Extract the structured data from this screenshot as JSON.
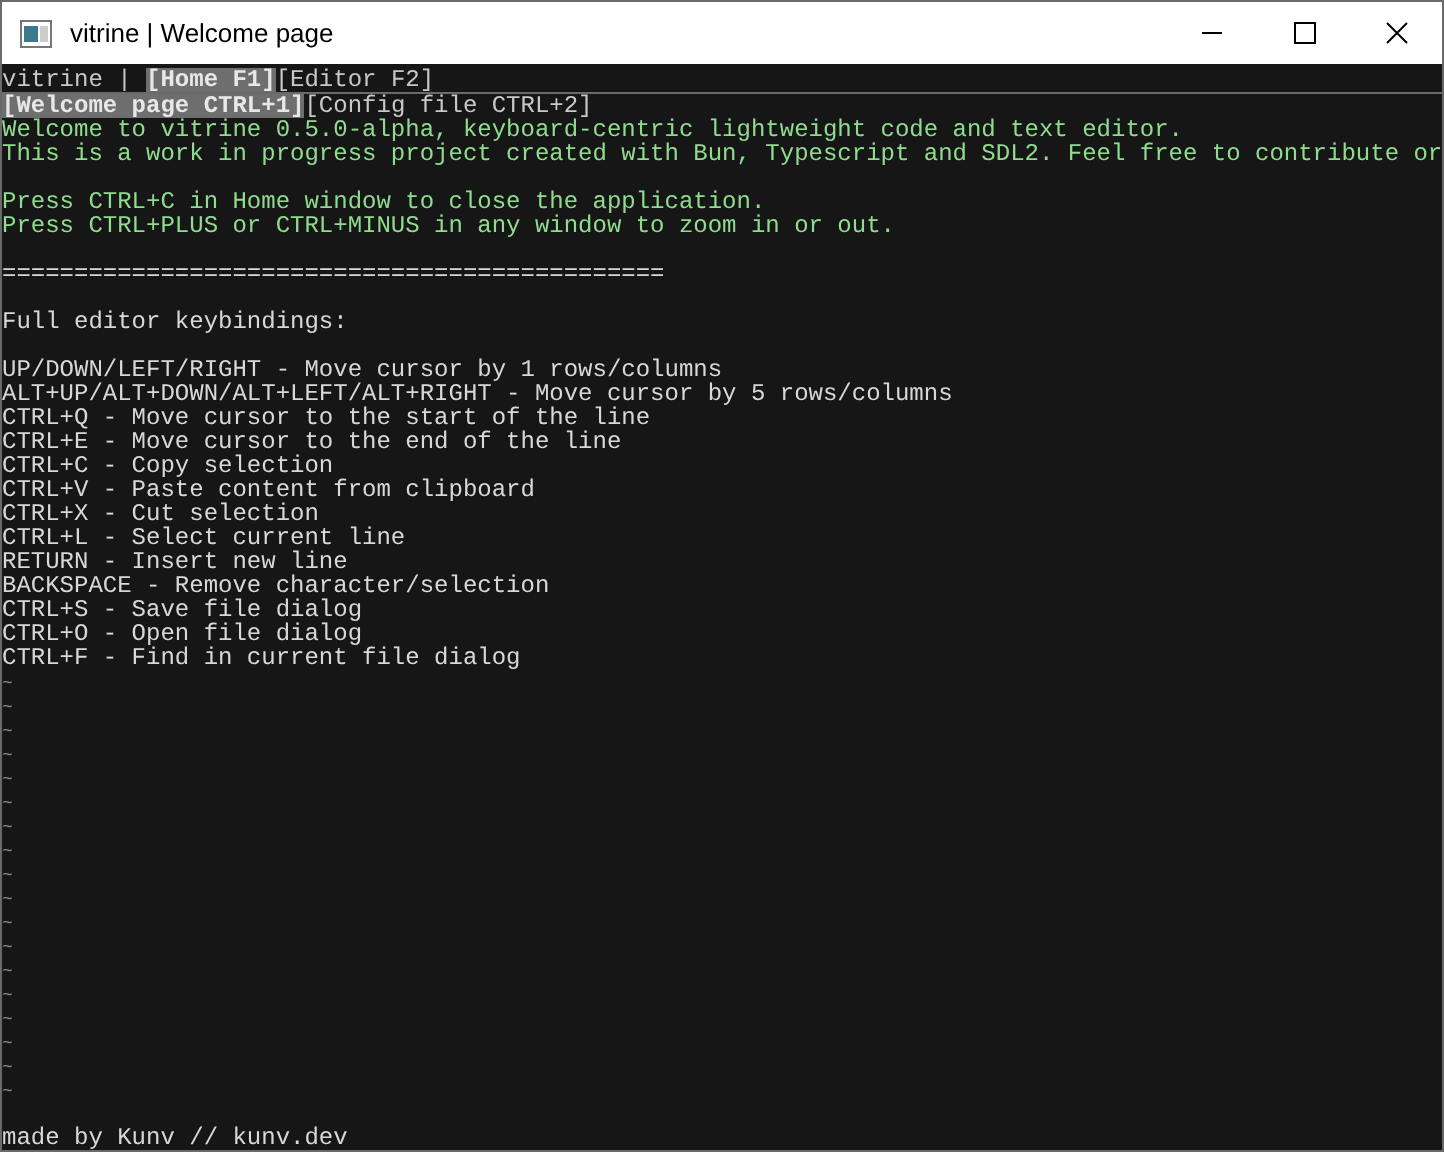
{
  "window": {
    "title": "vitrine | Welcome page"
  },
  "app_label": "vitrine | ",
  "window_tabs": [
    {
      "label": "[Home F1]",
      "selected": true
    },
    {
      "label": "[Editor F2]",
      "selected": false
    }
  ],
  "page_tabs": [
    {
      "label": "[Welcome page CTRL+1]",
      "selected": true
    },
    {
      "label": "[Config file CTRL+2]",
      "selected": false
    }
  ],
  "lines": [
    {
      "kind": "green",
      "text": "Welcome to vitrine 0.5.0-alpha, keyboard-centric lightweight code and text editor."
    },
    {
      "kind": "green",
      "text": "This is a work in progress project created with Bun, Typescript and SDL2. Feel free to contribute or"
    },
    {
      "kind": "blank"
    },
    {
      "kind": "green",
      "text": "Press CTRL+C in Home window to close the application."
    },
    {
      "kind": "green",
      "text": "Press CTRL+PLUS or CTRL+MINUS in any window to zoom in or out."
    },
    {
      "kind": "blank"
    },
    {
      "kind": "plain",
      "text": "=============================================="
    },
    {
      "kind": "blank"
    },
    {
      "kind": "plain",
      "text": "Full editor keybindings:"
    },
    {
      "kind": "blank"
    },
    {
      "kind": "plain",
      "text": "UP/DOWN/LEFT/RIGHT - Move cursor by 1 rows/columns"
    },
    {
      "kind": "plain",
      "text": "ALT+UP/ALT+DOWN/ALT+LEFT/ALT+RIGHT - Move cursor by 5 rows/columns"
    },
    {
      "kind": "plain",
      "text": "CTRL+Q - Move cursor to the start of the line"
    },
    {
      "kind": "plain",
      "text": "CTRL+E - Move cursor to the end of the line"
    },
    {
      "kind": "plain",
      "text": "CTRL+C - Copy selection"
    },
    {
      "kind": "plain",
      "text": "CTRL+V - Paste content from clipboard"
    },
    {
      "kind": "plain",
      "text": "CTRL+X - Cut selection"
    },
    {
      "kind": "plain",
      "text": "CTRL+L - Select current line"
    },
    {
      "kind": "plain",
      "text": "RETURN - Insert new line"
    },
    {
      "kind": "plain",
      "text": "BACKSPACE - Remove character/selection"
    },
    {
      "kind": "plain",
      "text": "CTRL+S - Save file dialog"
    },
    {
      "kind": "plain",
      "text": "CTRL+O - Open file dialog"
    },
    {
      "kind": "plain",
      "text": "CTRL+F - Find in current file dialog"
    }
  ],
  "tildes": [
    "~",
    "~",
    "~",
    "~",
    "~",
    "~",
    "~",
    "~",
    "~",
    "~",
    "~",
    "~",
    "~",
    "~",
    "~",
    "~",
    "~",
    "~"
  ],
  "footer": "made by Kunv // kunv.dev"
}
